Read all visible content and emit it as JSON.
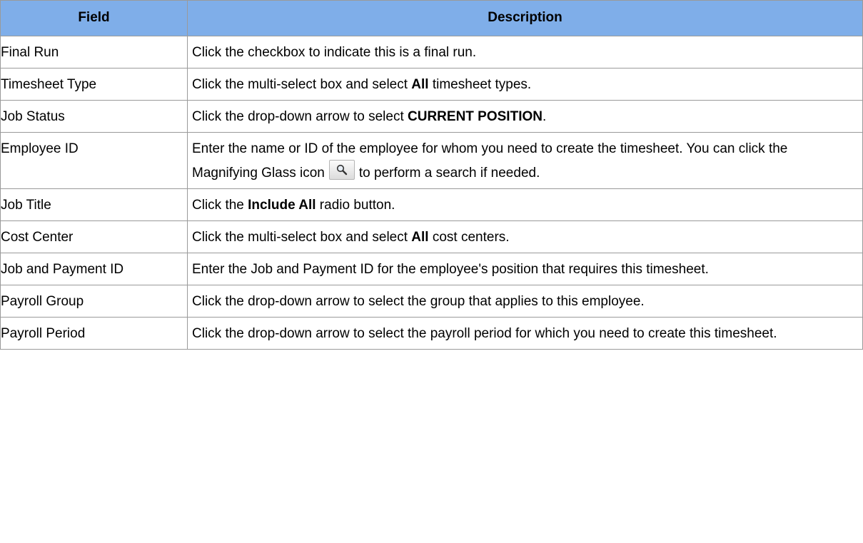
{
  "header": {
    "field": "Field",
    "description": "Description"
  },
  "rows": [
    {
      "field": "Final Run",
      "desc": [
        {
          "t": "Click the checkbox to indicate this is a final run."
        }
      ]
    },
    {
      "field": "Timesheet Type",
      "desc": [
        {
          "t": "Click the multi-select box and select "
        },
        {
          "t": "All",
          "b": true
        },
        {
          "t": " timesheet types."
        }
      ]
    },
    {
      "field": "Job Status",
      "desc": [
        {
          "t": "Click the drop-down arrow to select "
        },
        {
          "t": "CURRENT POSITION",
          "b": true
        },
        {
          "t": "."
        }
      ]
    },
    {
      "field": "Employee ID",
      "desc": [
        {
          "t": "Enter the name or ID of the employee for whom you need to create the timesheet. You can click the Magnifying Glass icon"
        },
        {
          "icon": "magnifying-glass-icon"
        },
        {
          "t": "to perform a search if needed."
        }
      ]
    },
    {
      "field": "Job Title",
      "desc": [
        {
          "t": "Click the "
        },
        {
          "t": "Include All",
          "b": true
        },
        {
          "t": " radio button."
        }
      ]
    },
    {
      "field": "Cost Center",
      "desc": [
        {
          "t": "Click the multi-select box and select "
        },
        {
          "t": "All",
          "b": true
        },
        {
          "t": " cost centers."
        }
      ]
    },
    {
      "field": "Job and Payment ID",
      "desc": [
        {
          "t": "Enter the Job and Payment ID for the employee's position that requires this timesheet."
        }
      ]
    },
    {
      "field": "Payroll Group",
      "desc": [
        {
          "t": "Click the drop-down arrow to select the group that applies to this employee."
        }
      ]
    },
    {
      "field": "Payroll Period",
      "desc": [
        {
          "t": "Click the drop-down arrow to select the payroll period for which you need to create this timesheet."
        }
      ]
    }
  ]
}
